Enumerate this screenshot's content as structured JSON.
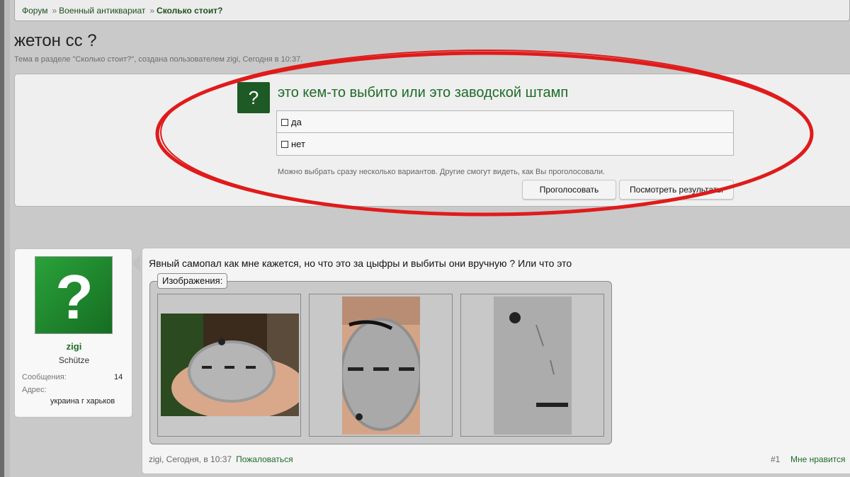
{
  "breadcrumb": {
    "items": [
      "Форум",
      "Военный антиквариат"
    ],
    "separator": "»",
    "current": "Сколько стоит?"
  },
  "thread": {
    "title": "жетон сс ?",
    "description": "Тема в разделе \"Сколько стоит?\", создана пользователем zigi, Сегодня в 10:37."
  },
  "poll": {
    "icon_text": "?",
    "question": "это кем-то выбито или это заводской штамп",
    "options": [
      "да",
      "нет"
    ],
    "hint": "Можно выбрать сразу несколько вариантов. Другие смогут видеть, как Вы проголосовали.",
    "vote_label": "Проголосовать",
    "results_label": "Посмотреть результаты"
  },
  "user": {
    "avatar_glyph": "?",
    "name": "zigi",
    "title": "Schütze",
    "messages_label": "Сообщения:",
    "messages_value": "14",
    "address_label": "Адрес:",
    "address_value": "украина г харьков"
  },
  "post": {
    "text": "Явный самопал как мне кажется, но что это за цыфры и выбиты они вручную ? Или что это",
    "attachments_label": "Изображения:",
    "author_time": "zigi, Сегодня, в 10:37",
    "report_label": "Пожаловаться",
    "number": "#1",
    "like_label": "Мне нравится"
  },
  "colors": {
    "accent_green": "#1e6b28",
    "annotation_red": "#e01b1b"
  }
}
